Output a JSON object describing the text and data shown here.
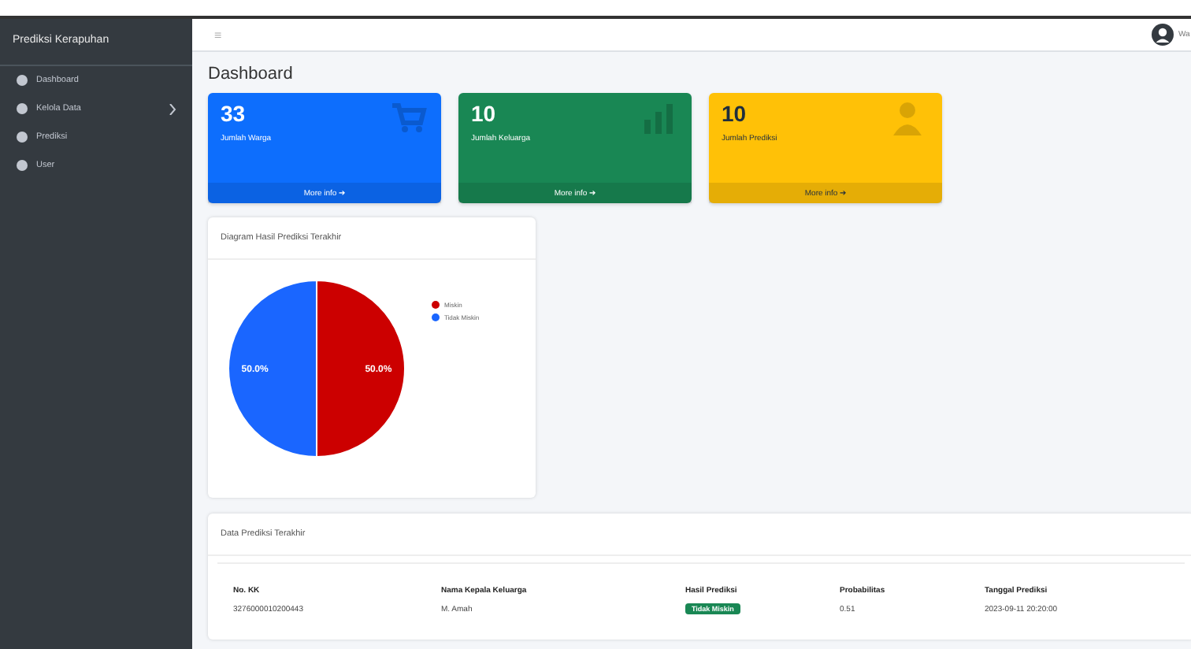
{
  "sidebar": {
    "brand": "Prediksi Kerapuhan",
    "items": [
      {
        "label": "Dashboard",
        "selected": false,
        "has_submenu": false
      },
      {
        "label": "Kelola Data",
        "selected": false,
        "has_submenu": true
      },
      {
        "label": "Prediksi",
        "selected": false,
        "has_submenu": false
      },
      {
        "label": "User",
        "selected": false,
        "has_submenu": false
      }
    ]
  },
  "navbar": {
    "menu_icon": "≡",
    "user": "Wa"
  },
  "page_title": "Dashboard",
  "stat_cards": [
    {
      "value": "33",
      "label": "Jumlah Warga",
      "link": "More info ➔",
      "color": "#0d6efd",
      "kind": "cart"
    },
    {
      "value": "10",
      "label": "Jumlah Keluarga",
      "link": "More info ➔",
      "color": "#198754",
      "kind": "chart"
    },
    {
      "value": "10",
      "label": "Jumlah Prediksi",
      "link": "More info ➔",
      "color": "#ffc107",
      "kind": "user"
    }
  ],
  "pie_card": {
    "title": "Diagram Hasil Prediksi Terakhir",
    "chart_data": {
      "type": "pie",
      "categories": [
        "Miskin",
        "Tidak Miskin"
      ],
      "values": [
        50.0,
        50.0
      ],
      "colors": [
        "#cc0000",
        "#1a66ff"
      ],
      "data_labels": true,
      "value_labels": [
        "50.0%",
        "50.0%"
      ],
      "legend": "right"
    }
  },
  "table": {
    "title": "Data Prediksi Terakhir",
    "columns": [
      "No. KK",
      "Nama Kepala Keluarga",
      "Hasil Prediksi",
      "Probabilitas",
      "Tanggal Prediksi"
    ],
    "rows": [
      [
        "3276000010200443",
        "M. Amah",
        {
          "badge": "Tidak Miskin",
          "color": "#198754"
        },
        "0.51",
        "2023-09-11 20:20:00"
      ]
    ]
  }
}
